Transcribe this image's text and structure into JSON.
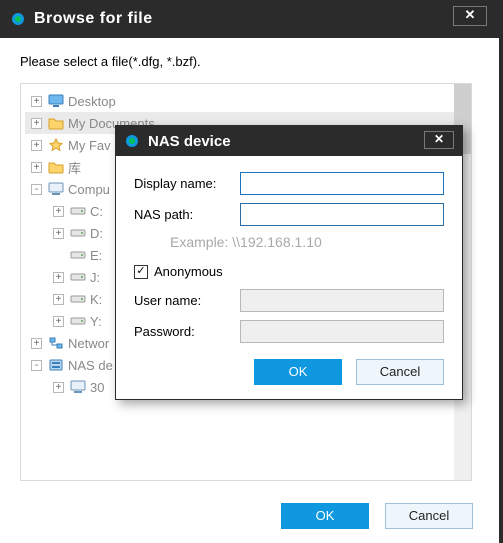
{
  "window": {
    "title": "Browse for file",
    "close_glyph": "✕",
    "prompt": "Please select a file(*.dfg, *.bzf)."
  },
  "tree": {
    "items": [
      {
        "label": "Desktop",
        "depth": 0,
        "exp": "+",
        "icon": "desktop",
        "sel": false
      },
      {
        "label": "My Documents",
        "depth": 0,
        "exp": "+",
        "icon": "folder",
        "sel": true
      },
      {
        "label": "My Fav",
        "depth": 0,
        "exp": "+",
        "icon": "star",
        "sel": false
      },
      {
        "label": "库",
        "depth": 0,
        "exp": "+",
        "icon": "folder",
        "sel": false
      },
      {
        "label": "Compu",
        "depth": 0,
        "exp": "-",
        "icon": "computer",
        "sel": false
      },
      {
        "label": "C:",
        "depth": 1,
        "exp": "+",
        "icon": "drive",
        "sel": false
      },
      {
        "label": "D:",
        "depth": 1,
        "exp": "+",
        "icon": "drive",
        "sel": false
      },
      {
        "label": "E:",
        "depth": 1,
        "exp": "",
        "icon": "drive",
        "sel": false
      },
      {
        "label": "J:",
        "depth": 1,
        "exp": "+",
        "icon": "drive",
        "sel": false
      },
      {
        "label": "K:",
        "depth": 1,
        "exp": "+",
        "icon": "drive",
        "sel": false
      },
      {
        "label": "Y:",
        "depth": 1,
        "exp": "+",
        "icon": "drive",
        "sel": false
      },
      {
        "label": "Networ",
        "depth": 0,
        "exp": "+",
        "icon": "network",
        "sel": false
      },
      {
        "label": "NAS de",
        "depth": 0,
        "exp": "-",
        "icon": "nas",
        "sel": false
      },
      {
        "label": "30",
        "depth": 1,
        "exp": "+",
        "icon": "computer",
        "sel": false
      }
    ]
  },
  "footer": {
    "ok_label": "OK",
    "cancel_label": "Cancel"
  },
  "modal": {
    "title": "NAS device",
    "close_glyph": "✕",
    "display_name_label": "Display name:",
    "display_name_value": "",
    "nas_path_label": "NAS path:",
    "nas_path_value": "",
    "example_text": "Example: \\\\192.168.1.10",
    "anonymous_label": "Anonymous",
    "anonymous_checked": true,
    "user_name_label": "User name:",
    "user_name_value": "",
    "password_label": "Password:",
    "password_value": "",
    "ok_label": "OK",
    "cancel_label": "Cancel"
  },
  "colors": {
    "primary": "#0f97e0",
    "titlebar": "#2b2b2b"
  }
}
